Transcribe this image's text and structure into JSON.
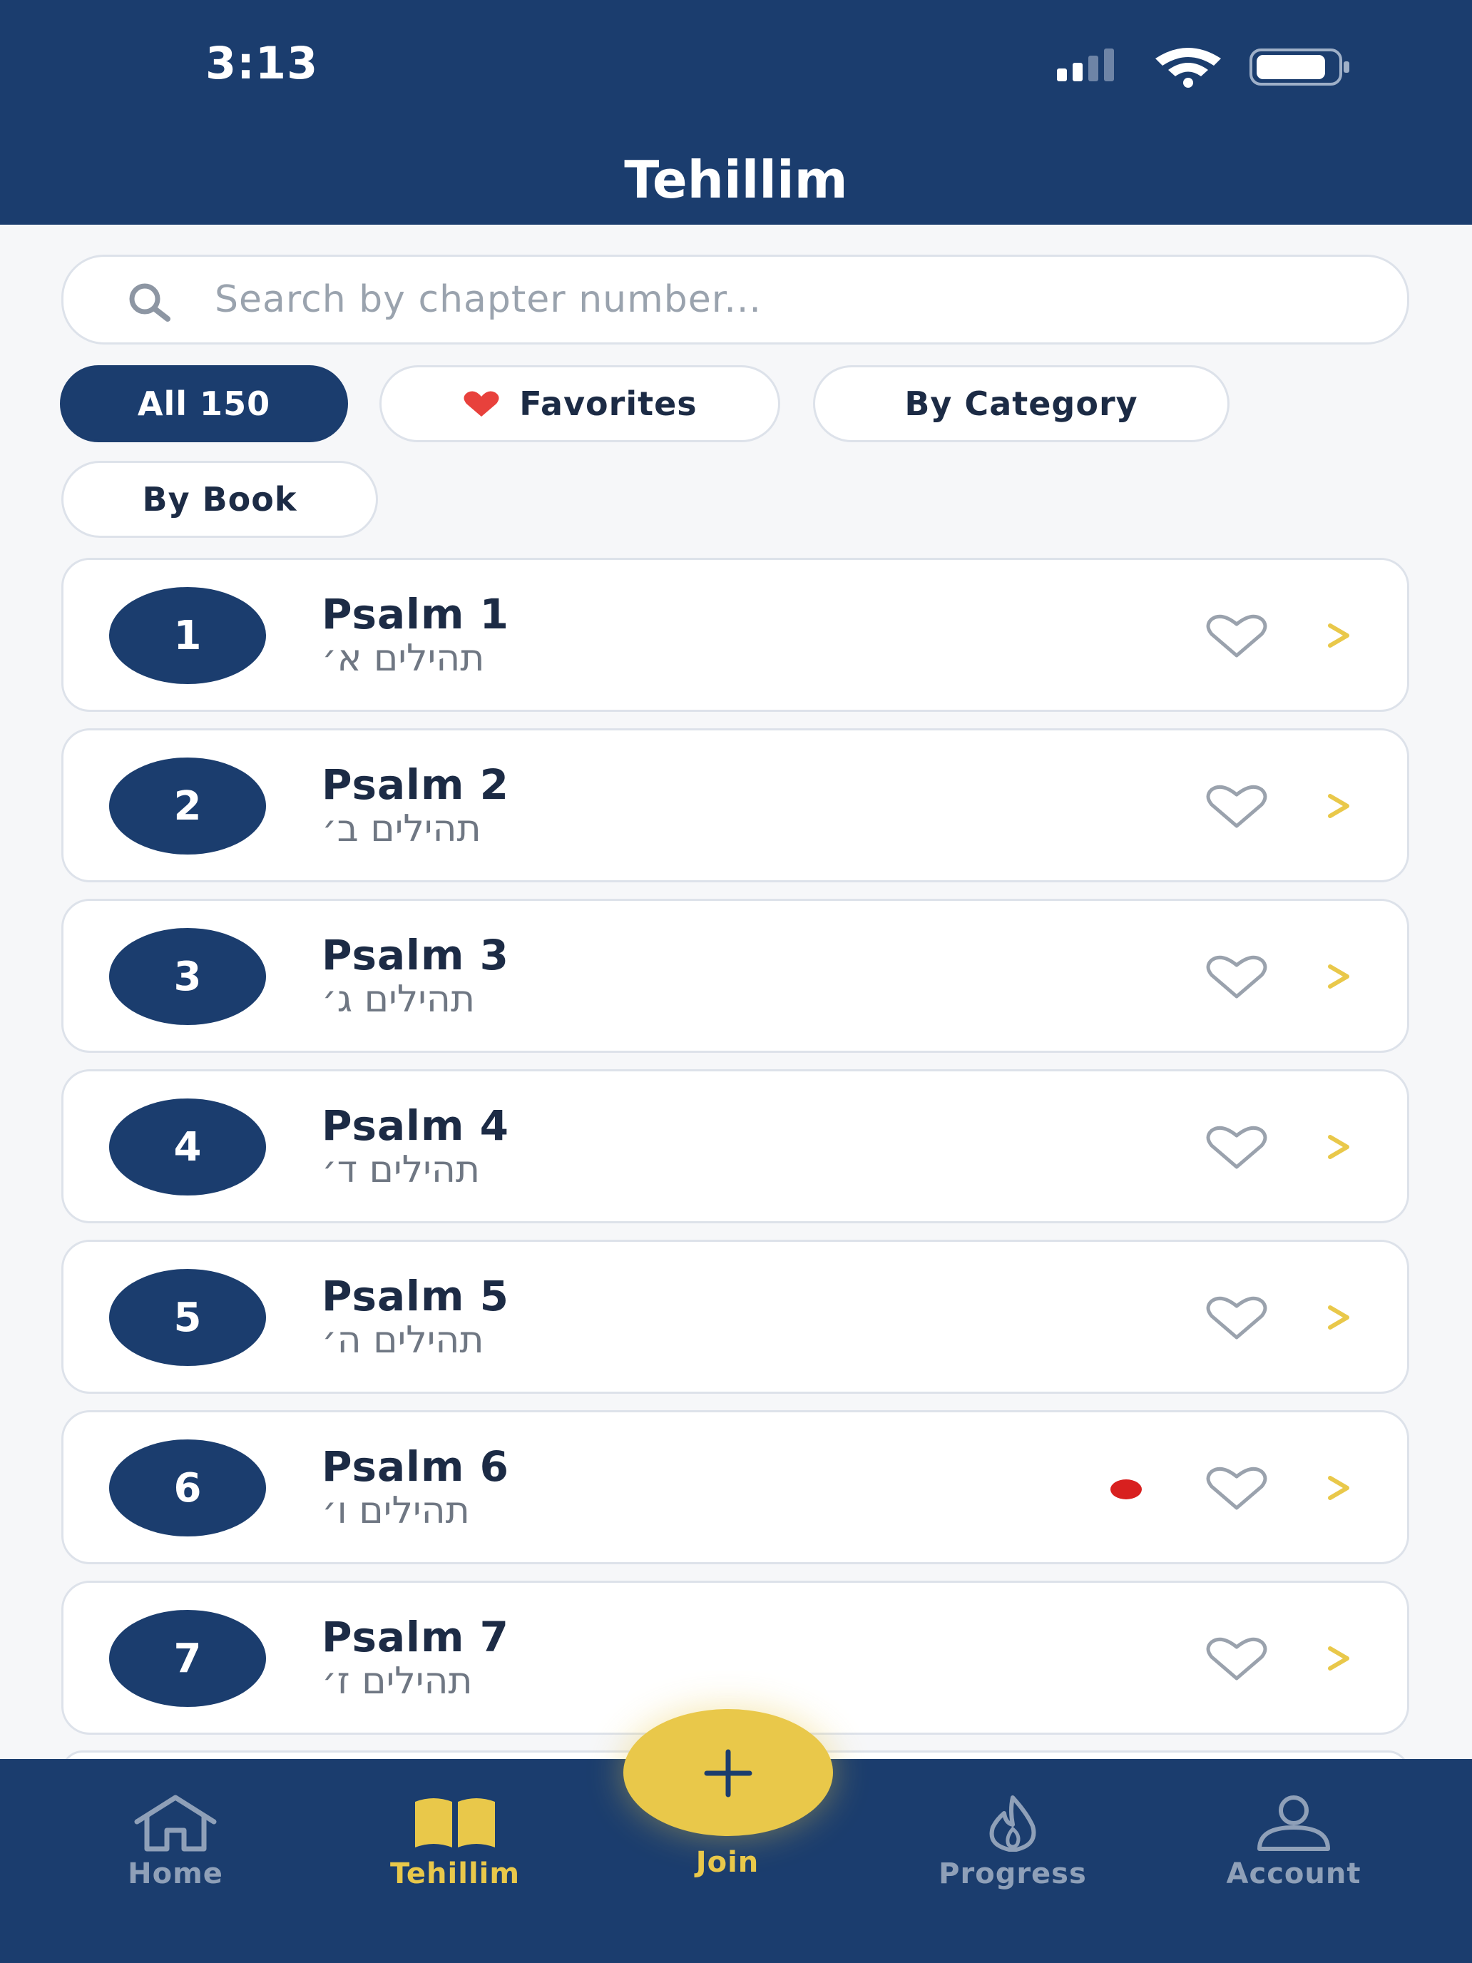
{
  "status_bar": {
    "time": "3:13"
  },
  "header": {
    "title": "Tehillim"
  },
  "search": {
    "placeholder": "Search by chapter number..."
  },
  "filters": [
    {
      "label": "All 150",
      "active": true
    },
    {
      "label": "Favorites",
      "icon": "heart-filled-icon",
      "active": false
    },
    {
      "label": "By Category",
      "active": false
    },
    {
      "label": "By Book",
      "active": false
    }
  ],
  "psalms": [
    {
      "number": "1",
      "title": "Psalm 1",
      "hebrew": "תהילים א׳",
      "favorite": false,
      "unread_dot": false
    },
    {
      "number": "2",
      "title": "Psalm 2",
      "hebrew": "תהילים ב׳",
      "favorite": false,
      "unread_dot": false
    },
    {
      "number": "3",
      "title": "Psalm 3",
      "hebrew": "תהילים ג׳",
      "favorite": false,
      "unread_dot": false
    },
    {
      "number": "4",
      "title": "Psalm 4",
      "hebrew": "תהילים ד׳",
      "favorite": false,
      "unread_dot": false
    },
    {
      "number": "5",
      "title": "Psalm 5",
      "hebrew": "תהילים ה׳",
      "favorite": false,
      "unread_dot": false
    },
    {
      "number": "6",
      "title": "Psalm 6",
      "hebrew": "תהילים ו׳",
      "favorite": false,
      "unread_dot": true
    },
    {
      "number": "7",
      "title": "Psalm 7",
      "hebrew": "תהילים ז׳",
      "favorite": false,
      "unread_dot": false
    }
  ],
  "bottom_nav": {
    "items": [
      {
        "label": "Home",
        "icon": "home-icon",
        "active": false
      },
      {
        "label": "Tehillim",
        "icon": "book-icon",
        "active": true
      },
      {
        "label": "Join",
        "icon": "plus-icon",
        "active": false
      },
      {
        "label": "Progress",
        "icon": "flame-icon",
        "active": false
      },
      {
        "label": "Account",
        "icon": "user-icon",
        "active": false
      }
    ]
  },
  "colors": {
    "primary": "#1b3d6e",
    "accent": "#e9c84a",
    "favorite_red": "#e8413c",
    "dot_red": "#d8201f",
    "background": "#f6f7f9"
  }
}
